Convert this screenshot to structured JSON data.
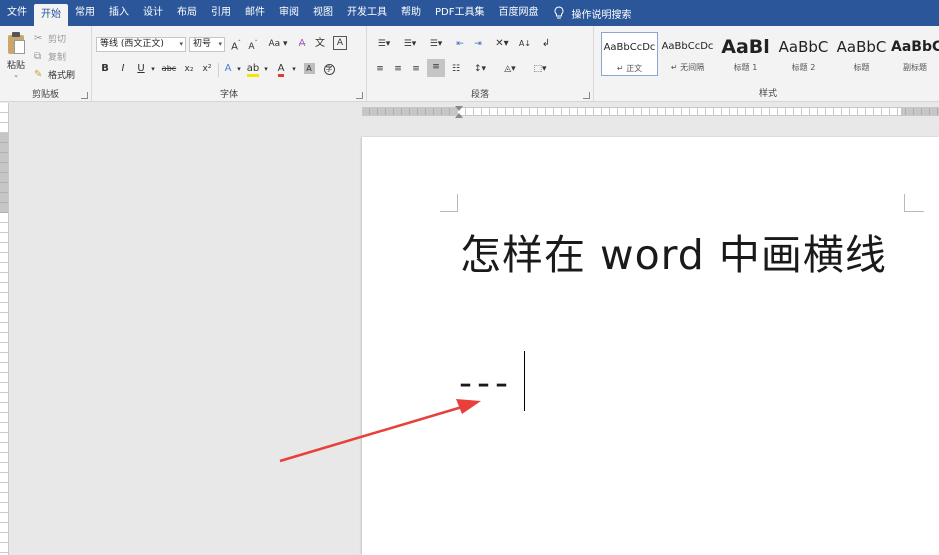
{
  "tabs": [
    {
      "label": "文件",
      "active": false
    },
    {
      "label": "开始",
      "active": true
    },
    {
      "label": "常用",
      "active": false
    },
    {
      "label": "插入",
      "active": false
    },
    {
      "label": "设计",
      "active": false
    },
    {
      "label": "布局",
      "active": false
    },
    {
      "label": "引用",
      "active": false
    },
    {
      "label": "邮件",
      "active": false
    },
    {
      "label": "审阅",
      "active": false
    },
    {
      "label": "视图",
      "active": false
    },
    {
      "label": "开发工具",
      "active": false
    },
    {
      "label": "帮助",
      "active": false
    },
    {
      "label": "PDF工具集",
      "active": false
    },
    {
      "label": "百度网盘",
      "active": false
    }
  ],
  "tell_me": "操作说明搜索",
  "clipboard": {
    "paste": "粘贴",
    "cut": "剪切",
    "copy": "复制",
    "format_painter": "格式刷",
    "group_label": "剪贴板"
  },
  "font": {
    "family": "等线 (西文正文)",
    "size": "初号",
    "group_label": "字体",
    "bold": "B",
    "italic": "I",
    "underline": "U",
    "strike": "abc",
    "subscript": "x₂",
    "superscript": "x²"
  },
  "paragraph": {
    "group_label": "段落"
  },
  "styles": {
    "group_label": "样式",
    "items": [
      {
        "sample": "AaBbCcDc",
        "name": "↵ 正文",
        "selected": true
      },
      {
        "sample": "AaBbCcDc",
        "name": "↵ 无间隔",
        "selected": false
      },
      {
        "sample": "AaBl",
        "name": "标题 1",
        "selected": false
      },
      {
        "sample": "AaBbC",
        "name": "标题 2",
        "selected": false
      },
      {
        "sample": "AaBbC",
        "name": "标题",
        "selected": false
      },
      {
        "sample": "AaBbC",
        "name": "副标题",
        "selected": false
      }
    ]
  },
  "document": {
    "title": "怎样在 word 中画横线",
    "typed": "---"
  },
  "colors": {
    "tabbar": "#2b579a",
    "annotation_arrow": "#e8403a"
  }
}
